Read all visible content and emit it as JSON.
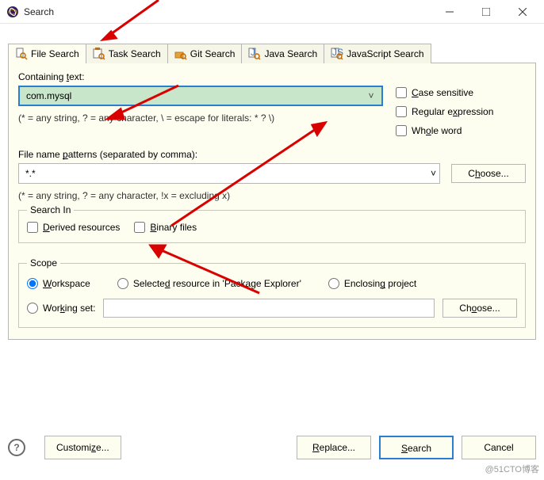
{
  "window": {
    "title": "Search"
  },
  "tabs": {
    "file": "File Search",
    "task": "Task Search",
    "git": "Git Search",
    "java": "Java Search",
    "js": "JavaScript Search"
  },
  "containing": {
    "label_pre": "Containing ",
    "label_u": "t",
    "label_post": "ext:",
    "value": "com.mysql",
    "hint": "(* = any string, ? = any character, \\ = escape for literals: * ? \\)"
  },
  "options": {
    "case_u": "C",
    "case_post": "ase sensitive",
    "regex_pre": "Regular e",
    "regex_u": "x",
    "regex_post": "pression",
    "whole_pre": "Wh",
    "whole_u": "o",
    "whole_post": "le word"
  },
  "patterns": {
    "label_pre": "File name ",
    "label_u": "p",
    "label_post": "atterns (separated by comma):",
    "value": "*.*",
    "choose_pre": "C",
    "choose_u": "h",
    "choose_post": "oose...",
    "hint": "(* = any string, ? = any character, !x = excluding x)"
  },
  "searchIn": {
    "legend": "Search In",
    "derived_u": "D",
    "derived_post": "erived resources",
    "binary_u": "B",
    "binary_post": "inary files"
  },
  "scope": {
    "legend": "Scope",
    "workspace_u": "W",
    "workspace_post": "orkspace",
    "selected_pre": "Selecte",
    "selected_u": "d",
    "selected_post": " resource in 'Package Explorer'",
    "enclosing_pre": "Enclosin",
    "enclosing_u": "g",
    "enclosing_post": " project",
    "working_pre": "Wor",
    "working_u": "k",
    "working_post": "ing set:",
    "choose_pre": "Ch",
    "choose_u": "o",
    "choose_post": "ose..."
  },
  "footer": {
    "customize_pre": "Customi",
    "customize_u": "z",
    "customize_post": "e...",
    "replace_u": "R",
    "replace_post": "eplace...",
    "search_u": "S",
    "search_post": "earch",
    "cancel": "Cancel"
  },
  "watermark": "@51CTO博客"
}
